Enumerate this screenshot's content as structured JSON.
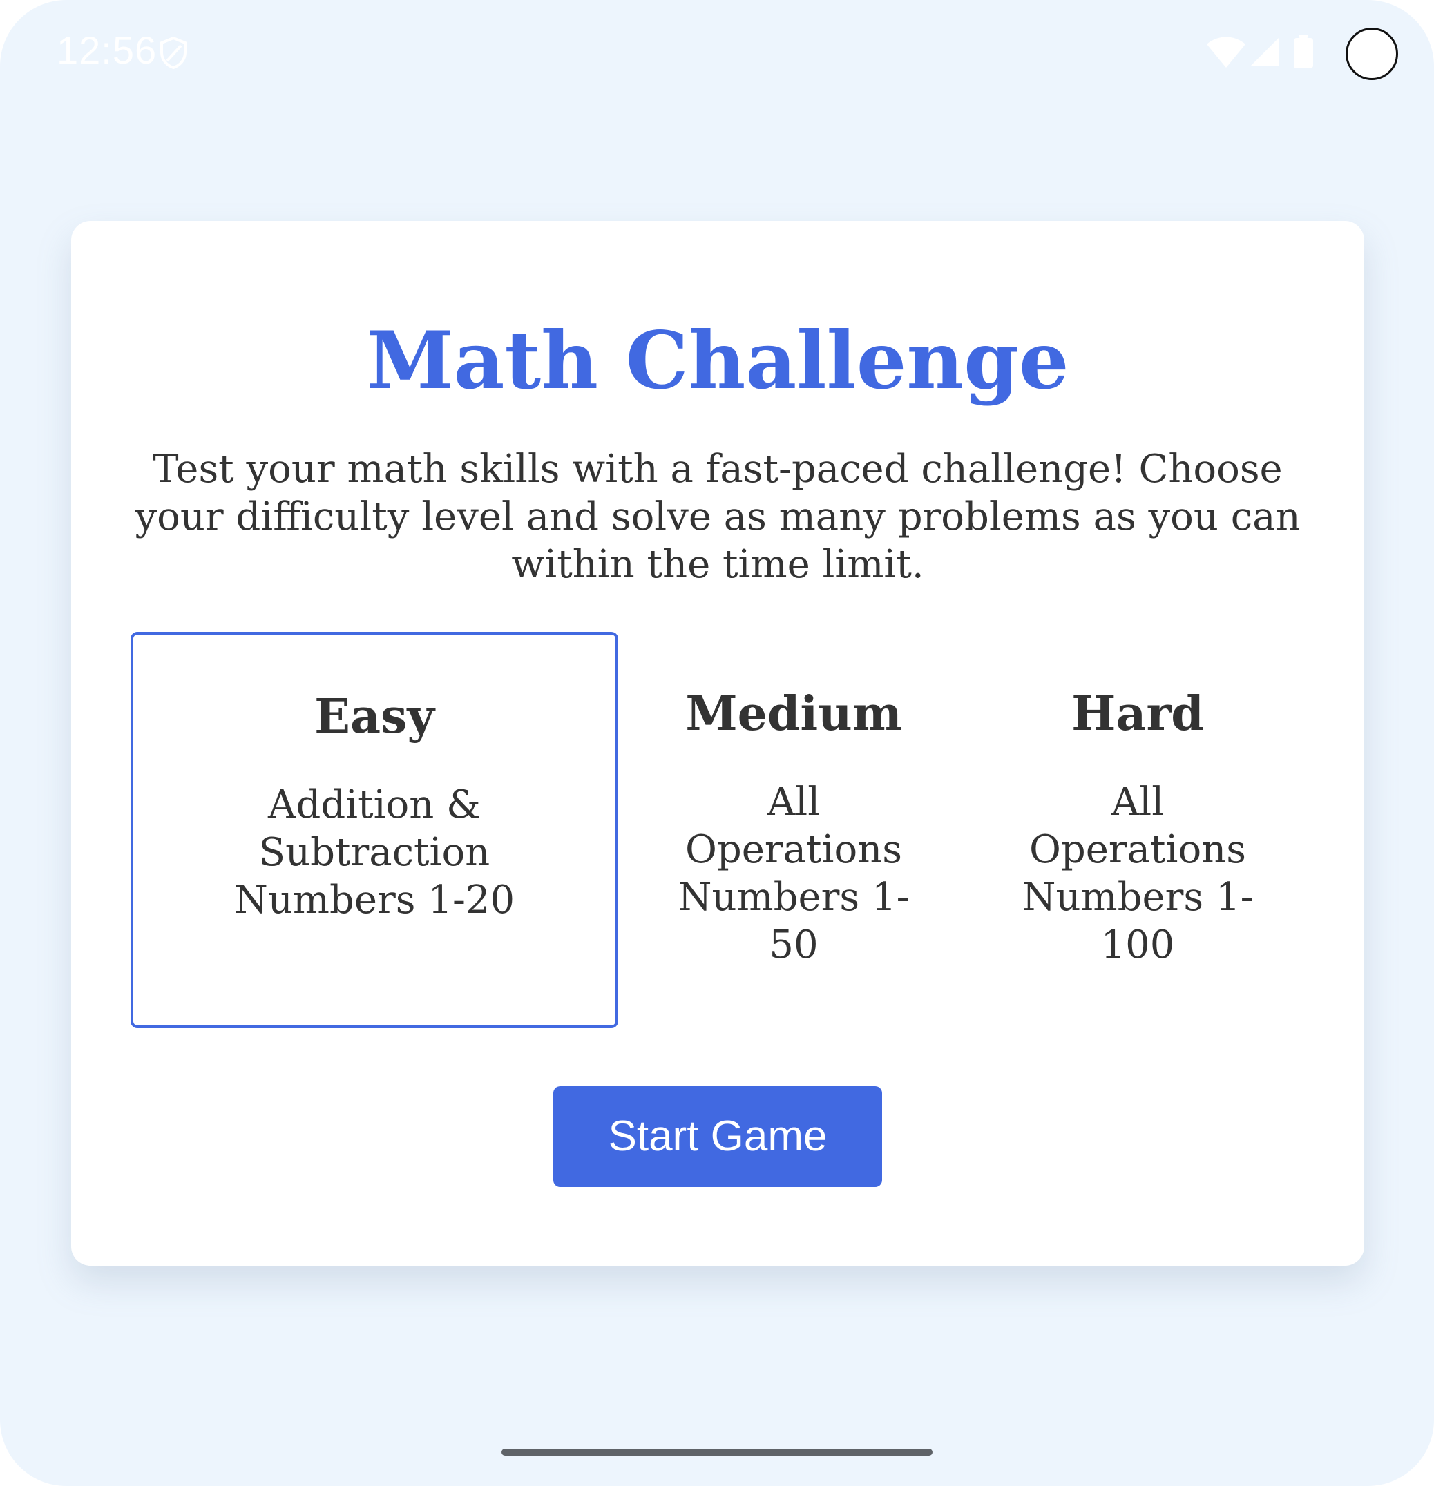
{
  "status_bar": {
    "time": "12:56",
    "icons": [
      "shield-icon",
      "wifi-icon",
      "signal-icon",
      "battery-icon"
    ]
  },
  "app": {
    "title": "Math Challenge",
    "description": "Test your math skills with a fast-paced challenge! Choose your difficulty level and solve as many problems as you can within the time limit.",
    "difficulty_options": [
      {
        "label": "Easy",
        "description": "Addition &\nSubtraction\nNumbers 1-20",
        "selected": true
      },
      {
        "label": "Medium",
        "description": "All\nOperations\nNumbers 1-\n50",
        "selected": false
      },
      {
        "label": "Hard",
        "description": "All\nOperations\nNumbers 1-\n100",
        "selected": false
      }
    ],
    "start_button_label": "Start Game"
  },
  "colors": {
    "accent": "#4169e1",
    "background": "#edf5fd",
    "card": "#ffffff",
    "text": "#333333"
  }
}
